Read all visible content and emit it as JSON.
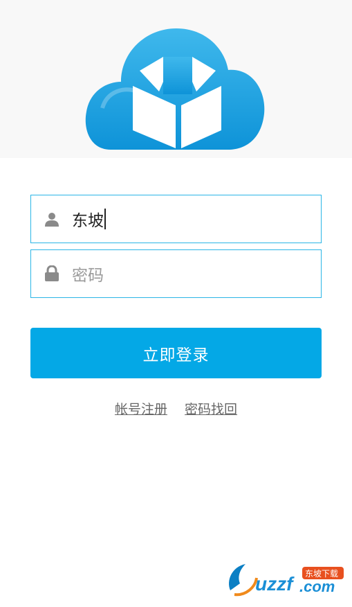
{
  "username": {
    "value": "东坡"
  },
  "password": {
    "placeholder": "密码"
  },
  "login_button": "立即登录",
  "links": {
    "register": "帐号注册",
    "recover": "密码找回"
  },
  "watermark": {
    "text": "uzzf.com",
    "badge": "东坡下载"
  },
  "colors": {
    "accent": "#04a8e6",
    "border": "#2ab5e6",
    "cloud": "#1ea1df"
  },
  "icons": {
    "user": "user-icon",
    "lock": "lock-icon",
    "logo": "cloud-download-logo"
  }
}
